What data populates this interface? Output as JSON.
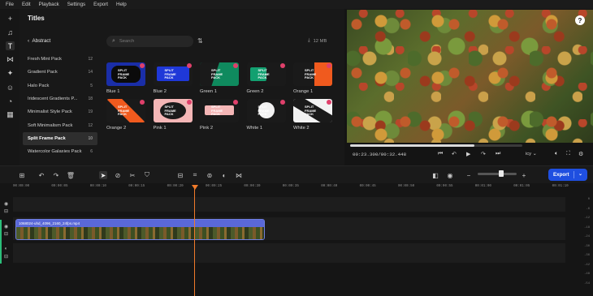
{
  "menu": [
    "File",
    "Edit",
    "Playback",
    "Settings",
    "Export",
    "Help"
  ],
  "rail_icons": [
    "add-icon",
    "music-icon",
    "text-icon",
    "transition-icon",
    "effects-icon",
    "sticker-icon",
    "filter-icon",
    "template-icon"
  ],
  "panel": {
    "title": "Titles",
    "back_label": "Abstract",
    "search_placeholder": "Search",
    "size_label": "12 MB"
  },
  "categories": [
    {
      "name": "Fresh Mint Pack",
      "count": "12"
    },
    {
      "name": "Gradient Pack",
      "count": "14"
    },
    {
      "name": "Halo Pack",
      "count": "5"
    },
    {
      "name": "Iridescent Gradients P...",
      "count": "18"
    },
    {
      "name": "Minimalist Style Pack",
      "count": "19"
    },
    {
      "name": "Soft Minimalism Pack",
      "count": "12"
    },
    {
      "name": "Split Frame Pack",
      "count": "10",
      "active": true
    },
    {
      "name": "Watercolor Galaxies Pack",
      "count": "6"
    }
  ],
  "tiles": [
    {
      "label": "Blue 1",
      "bg": "#1a2ea8",
      "accent": "#0b0b0b",
      "word": "SPLIT FRAME PACK"
    },
    {
      "label": "Blue 2",
      "bg": "#1a1a1a",
      "accent": "#1f38d8",
      "word": "SPLIT FRAME PACK"
    },
    {
      "label": "Green 1",
      "bg": "#0f8a5e",
      "accent": "#1a1a1a",
      "word": "SPLIT FRAME PACK"
    },
    {
      "label": "Green 2",
      "bg": "#1a1a1a",
      "accent": "#12a070",
      "word": "SPLIT FRAME PACK"
    },
    {
      "label": "Orange 1",
      "bg": "#1a1a1a",
      "accent": "#f05a1e",
      "word": "SPLIT FRAME PACK"
    },
    {
      "label": "Orange 2",
      "bg": "#1a1a1a",
      "accent": "#f05a1e",
      "word": "SPLIT FRAME PACK"
    },
    {
      "label": "Pink 1",
      "bg": "#f4b6b6",
      "accent": "#1a1a1a",
      "word": "SPLIT FRAME PACK"
    },
    {
      "label": "Pink 2",
      "bg": "#1a1a1a",
      "accent": "#f4b6b6",
      "word": "SPLIT FRAME PACK"
    },
    {
      "label": "White 1",
      "bg": "#1a1a1a",
      "accent": "#f2f2f2",
      "word": "SPLIT FRAME PACK"
    },
    {
      "label": "White 2",
      "bg": "#f2f2f2",
      "accent": "#1a1a1a",
      "word": "SPLIT FRAME PACK"
    }
  ],
  "player": {
    "timecode": "00:23.300/00:32.448",
    "progress": 0.72,
    "quality": "icy"
  },
  "toolbar": {
    "export_label": "Export"
  },
  "ruler": [
    "00:00:00",
    "00:00:05",
    "00:00:10",
    "00:00:15",
    "00:00:20",
    "00:00:25",
    "00:00:30",
    "00:00:35",
    "00:00:40",
    "00:00:45",
    "00:00:50",
    "00:00:55",
    "00:01:00",
    "00:01:05",
    "00:01:10"
  ],
  "clip": {
    "title": "1068024-uhd_4096_2160_24fps.mp4"
  },
  "meter_labels": [
    "0",
    "-6",
    "-12",
    "-18",
    "-24",
    "-30",
    "-36",
    "-42",
    "-48",
    "-54"
  ]
}
